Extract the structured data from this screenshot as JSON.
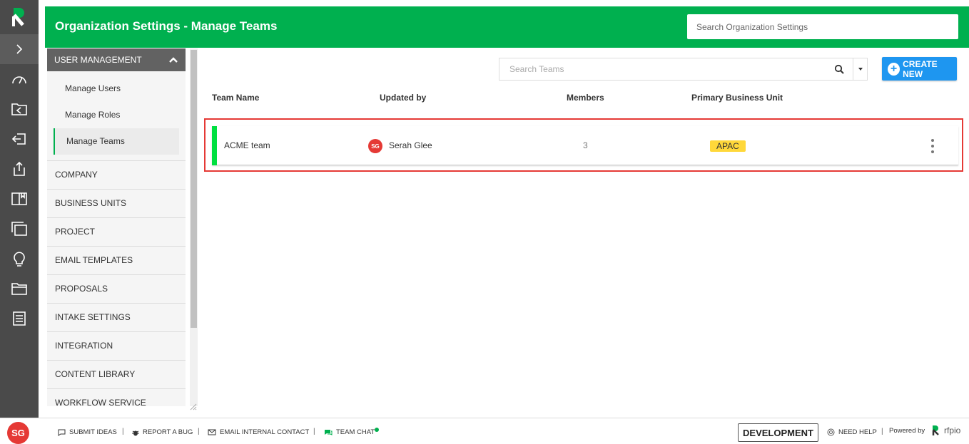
{
  "header": {
    "title": "Organization Settings - Manage Teams",
    "search_placeholder": "Search Organization Settings"
  },
  "rail": {
    "icons": [
      "rfpio-logo-icon",
      "chevron-right-icon",
      "dashboard-icon",
      "import-icon",
      "exit-icon",
      "upload-icon",
      "book-icon",
      "layers-icon",
      "lightbulb-icon",
      "folder-icon",
      "list-icon"
    ]
  },
  "sidebar": {
    "section_title": "USER MANAGEMENT",
    "sub_items": [
      {
        "label": "Manage Users"
      },
      {
        "label": "Manage Roles"
      },
      {
        "label": "Manage Teams",
        "active": true
      }
    ],
    "items": [
      {
        "label": "COMPANY"
      },
      {
        "label": "BUSINESS UNITS"
      },
      {
        "label": "PROJECT"
      },
      {
        "label": "EMAIL TEMPLATES"
      },
      {
        "label": "PROPOSALS"
      },
      {
        "label": "INTAKE SETTINGS"
      },
      {
        "label": "INTEGRATION"
      },
      {
        "label": "CONTENT LIBRARY"
      },
      {
        "label": "WORKFLOW SERVICE"
      }
    ]
  },
  "toolbar": {
    "search_placeholder": "Search Teams",
    "create_label": "CREATE NEW"
  },
  "table": {
    "columns": [
      "Team Name",
      "Updated by",
      "Members",
      "Primary Business Unit"
    ],
    "rows": [
      {
        "team_name": "ACME team",
        "updated_by_initials": "SG",
        "updated_by": "Serah Glee",
        "members": "3",
        "business_unit": "APAC"
      }
    ]
  },
  "footer": {
    "user_initials": "SG",
    "links": [
      "SUBMIT IDEAS",
      "REPORT A BUG",
      "EMAIL INTERNAL CONTACT",
      "TEAM CHAT"
    ],
    "environment": "DEVELOPMENT",
    "help": "NEED HELP",
    "powered_by": "Powered by",
    "brand": "rfpio"
  },
  "colors": {
    "header_green": "#00b04f",
    "rail": "#4a4a4a",
    "create_blue": "#1e96f0",
    "highlight_red": "#e53935",
    "bu_badge": "#ffd83a"
  }
}
